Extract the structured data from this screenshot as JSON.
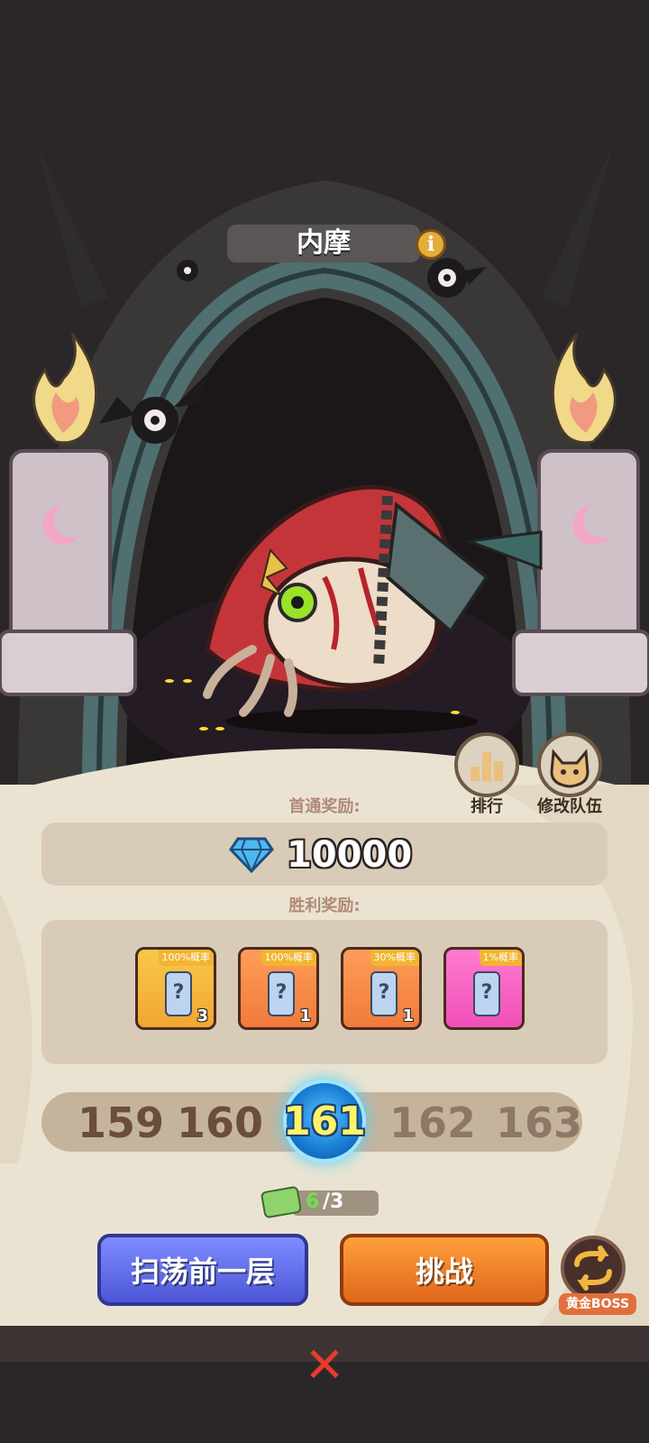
{
  "boss": {
    "name": "内摩",
    "info_icon": "info-icon"
  },
  "side_buttons": {
    "ranking_label": "排行",
    "team_label": "修改队伍"
  },
  "first_clear": {
    "title": "首通奖励:",
    "amount": "10000",
    "icon": "diamond-icon"
  },
  "victory": {
    "title": "胜利奖励:",
    "items": [
      {
        "chance": "100%概率",
        "count": "3",
        "color": "#f2a632"
      },
      {
        "chance": "100%概率",
        "count": "1",
        "color": "#f07a3a"
      },
      {
        "chance": "30%概率",
        "count": "1",
        "color": "#f07a3a"
      },
      {
        "chance": "1%概率",
        "count": "",
        "color": "#f04fb8"
      }
    ]
  },
  "levels": {
    "prev2": "159",
    "prev1": "160",
    "current": "161",
    "next1": "162",
    "next2": "163"
  },
  "tickets": {
    "have": "6",
    "max": "/3"
  },
  "actions": {
    "sweep_label": "扫荡前一层",
    "challenge_label": "挑战",
    "gold_boss_label": "黄金BOSS"
  },
  "close_icon": "close-icon"
}
